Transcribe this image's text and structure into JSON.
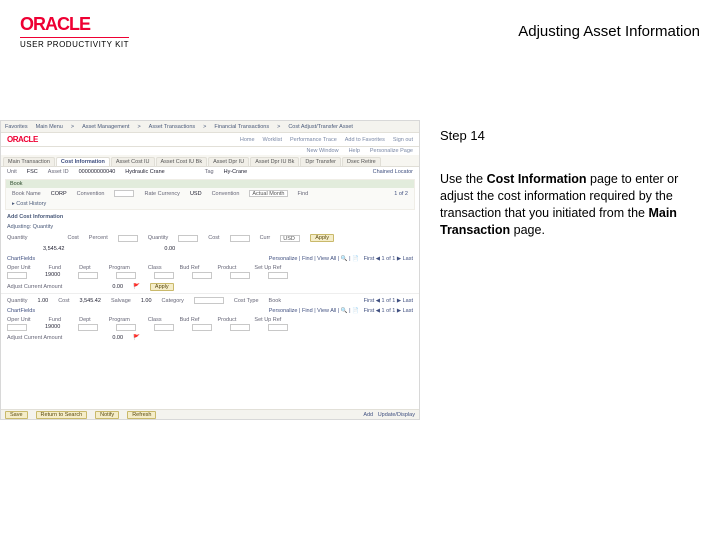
{
  "brand": {
    "name": "ORACLE",
    "sub": "USER PRODUCTIVITY KIT"
  },
  "doc_title": "Adjusting Asset Information",
  "step": {
    "label": "Step 14",
    "text_pre": "Use the ",
    "bold1": "Cost Information",
    "text_mid": " page to enter or adjust the cost information required by the transaction that you initiated from the ",
    "bold2": "Main Transaction",
    "text_post": " page."
  },
  "shot": {
    "breadcrumb": [
      "Favorites",
      "Main Menu",
      "Asset Management",
      "Asset Transactions",
      "Financial Transactions",
      "Cost Adjust/Transfer Asset"
    ],
    "nav": [
      "Home",
      "Worklist",
      "Performance Trace",
      "Add to Favorites",
      "Sign out"
    ],
    "toolbar_links": [
      "New Window",
      "Help",
      "Personalize Page"
    ],
    "tabs": [
      "Main Transaction",
      "Cost Information",
      "Asset Cost IU",
      "Asset Cost IU Bk",
      "Asset Dpr IU",
      "Asset Dpr IU Bk",
      "Dpr Transfer",
      "Dsec Retire"
    ],
    "active_tab_index": 1,
    "top_fields": {
      "unit": {
        "label": "Unit",
        "value": "FSC"
      },
      "asset_id": {
        "label": "Asset ID",
        "value": "000000000040"
      },
      "desc": {
        "value": "Hydraulic Crane"
      },
      "tag": {
        "label": "Tag",
        "value": "Hy-Crane"
      },
      "chained_header": "Chained Locator"
    },
    "book_head": "Book",
    "book_row": {
      "book_name_l": "Book Name",
      "book_name_v": "CORP",
      "convention_l": "Convention",
      "convention_v": "",
      "rate_currency_l": "Rate Currency",
      "rate_currency_v": "USD",
      "convention2_l": "Convention",
      "convention2_v": "Actual Month",
      "find_l": "Find",
      "pager": "1 of 2"
    },
    "cost_hist": "Cost History",
    "sect1": "Add Cost Information",
    "sub1": {
      "label": "Adjusting: Quantity",
      "values_side": "—"
    },
    "row1": {
      "qty_l": "Quantity",
      "cost_l": "Cost",
      "percent_l": "Percent",
      "quantity_l": "Quantity",
      "cost2_l": "Cost",
      "curr_l": "Curr",
      "curr_v": "USD",
      "apply_btn": "Apply"
    },
    "row_vals": {
      "qty": "",
      "salvage": "3,545.42",
      "cost": "0.00"
    },
    "chart1": "ChartFields",
    "grid_cols": [
      "Oper Unit",
      "Fund",
      "Dept",
      "Program",
      "Class",
      "Bud Ref",
      "Product",
      "Set Up Ref"
    ],
    "grid_vals": [
      "",
      "19000",
      "",
      "",
      "",
      "",
      "",
      ""
    ],
    "minor_row": {
      "lbl": "Adjust Current Amount",
      "v": "0.00",
      "btn": "Apply"
    },
    "row2": {
      "qty_l": "Quantity",
      "qty_v": "1.00",
      "cost_l": "Cost",
      "cost_v": "3,545.42",
      "salvage_l": "Salvage",
      "salvage_v": "1.00",
      "category_l": "Category",
      "category_sel": "",
      "cost_type_l": "Cost Type",
      "book_l": "Book"
    },
    "chart2": "ChartFields",
    "grid_cols2": [
      "Oper Unit",
      "Fund",
      "Dept",
      "Program",
      "Class",
      "Bud Ref",
      "Product",
      "Set Up Ref"
    ],
    "grid_vals2": [
      "",
      "19000",
      "",
      "",
      "",
      "",
      "",
      ""
    ],
    "minor_row2": {
      "lbl": "Adjust Current Amount",
      "v": "0.00"
    },
    "footer": [
      "Save",
      "Return to Search",
      "Notify",
      "Refresh"
    ]
  }
}
